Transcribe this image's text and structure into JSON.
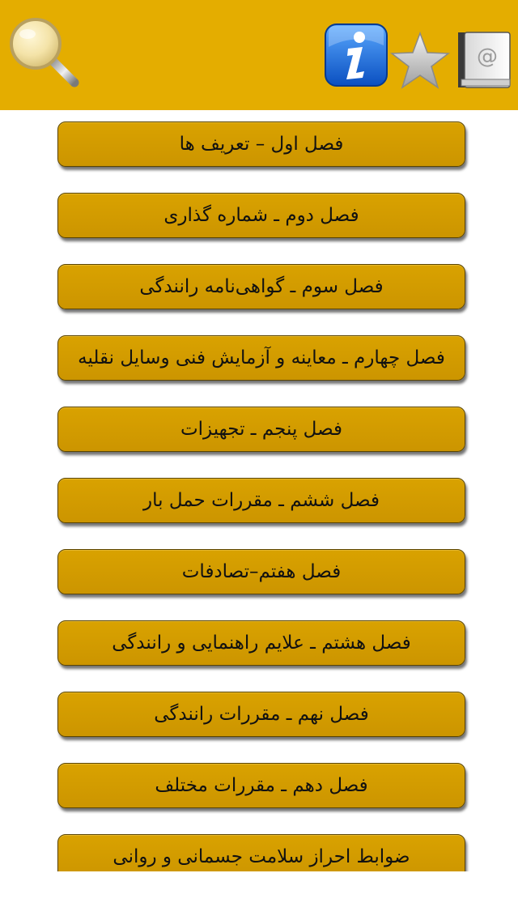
{
  "header": {
    "background_color": "#e4ad00",
    "icons": {
      "search": "search-icon",
      "info": "info-icon",
      "favorites": "star-icon",
      "contacts": "address-book-icon"
    }
  },
  "chapters": [
    {
      "label": "فصل اول – تعریف ها"
    },
    {
      "label": "فصل دوم ـ شماره گذاری"
    },
    {
      "label": "فصل سوم ـ گواهی‌نامه رانندگی"
    },
    {
      "label": "فصل چهارم ـ معاینه و آزمایش فنی وسایل نقلیه"
    },
    {
      "label": "فصل پنجم ـ تجهیزات"
    },
    {
      "label": "فصل ششم ـ مقررات حمل بار"
    },
    {
      "label": "فصل هفتم–تصادفات"
    },
    {
      "label": "فصل هشتم ـ علایم راهنمایی و رانندگی"
    },
    {
      "label": "فصل نهم ـ مقررات رانندگی"
    },
    {
      "label": "فصل دهم ـ مقررات مختلف"
    },
    {
      "label": "ضوابط احراز سلامت جسمانی و روانی"
    }
  ],
  "colors": {
    "button_fill": "#d49d00",
    "button_border": "#5a4400",
    "text": "#111111"
  }
}
